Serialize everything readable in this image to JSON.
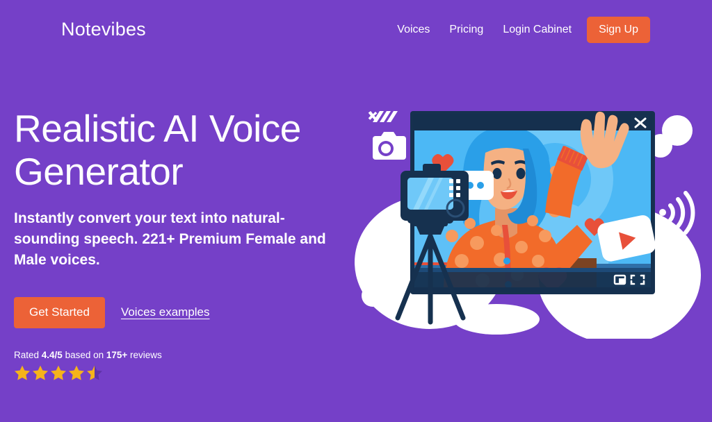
{
  "theme": {
    "background": "#7540c8",
    "accent_orange": "#ec6237",
    "text_white": "#ffffff",
    "star_gold": "#f5b31b",
    "player_navy": "#16314f",
    "screen_blue": "#4cb8f5"
  },
  "header": {
    "logo": "Notevibes",
    "nav": [
      {
        "label": "Voices",
        "name": "nav-link-voices"
      },
      {
        "label": "Pricing",
        "name": "nav-link-pricing"
      },
      {
        "label": "Login Cabinet",
        "name": "nav-link-login-cabinet"
      }
    ],
    "signup_label": "Sign Up"
  },
  "hero": {
    "title": "Realistic AI Voice Generator",
    "subtitle": "Instantly convert your text into natural-sounding speech. 221+ Premium Female and Male voices.",
    "primary_cta": "Get Started",
    "secondary_cta": "Voices examples",
    "rating": {
      "prefix": "Rated ",
      "score": "4.4/5",
      "middle": " based on ",
      "count": "175+",
      "suffix": " reviews",
      "full_stars": 4,
      "half_stars": 1,
      "max": 5
    }
  },
  "illustration": {
    "alt": "Woman with blue hair waving inside a video player window, with a camera on a tripod, hearts, chat bubble and play button",
    "icons": [
      "camera-icon",
      "close-icon",
      "chat-bubble-icon",
      "play-button-icon",
      "wifi-icon",
      "picture-in-picture-icon",
      "fullscreen-icon",
      "heart-icon"
    ]
  }
}
